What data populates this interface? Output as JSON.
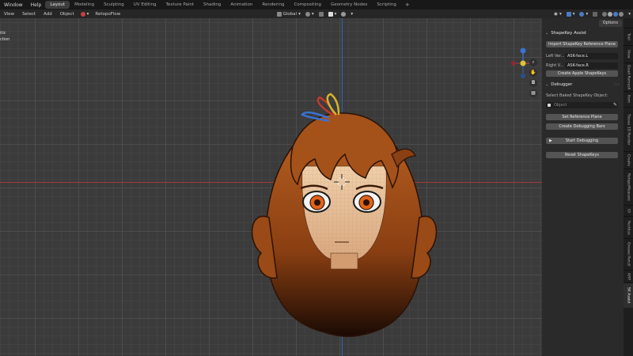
{
  "topbar": {
    "menus": [
      "Window",
      "Help"
    ],
    "workspaces": [
      "Layout",
      "Modeling",
      "Sculpting",
      "UV Editing",
      "Texture Paint",
      "Shading",
      "Animation",
      "Rendering",
      "Compositing",
      "Geometry Nodes",
      "Scripting"
    ],
    "active_workspace": "Layout",
    "add_tab": "+"
  },
  "header": {
    "menus": [
      "View",
      "Select",
      "Add",
      "Object"
    ],
    "addon_menu": "RetopoFlow",
    "transform_orientation": "Global"
  },
  "viewport": {
    "left_text": [
      "itic",
      "ction"
    ]
  },
  "sidebar": {
    "options_label": "Options",
    "shapekey_assist": {
      "title": "ShapeKey Assist",
      "import_button": "Import ShapeKey Reference Plane",
      "left_label": "Left Ver...",
      "left_value": "ASK-face.L",
      "right_label": "Right V...",
      "right_value": "ASK-face.R",
      "create_button": "Create Apple ShapeKeys"
    },
    "debugger": {
      "title": "Debugger",
      "select_label": "Select Baked ShapeKey Object:",
      "object_placeholder": "Object",
      "set_ref_button": "Set Reference Plane",
      "create_bars_button": "Create Debugging Bars",
      "start_button": "Start Debugging",
      "reset_button": "Reset ShapeKeys"
    },
    "tabs": [
      "Tool",
      "View",
      "Quad Remesh",
      "Item",
      "Tissue 3D Render",
      "Create",
      "RetopoMeasure",
      "ID",
      "Rectilux",
      "Grease Pencil",
      "ARP",
      "SK Assist"
    ],
    "active_tab": "SK Assist"
  },
  "colors": {
    "x_axis": "#a33a3a",
    "y_axis": "#2d66b8",
    "gizmo_blue": "#3a72d4",
    "gizmo_yellow": "#d8c63a",
    "gizmo_red": "#d23c4a",
    "gizmo_green": "#5aa83a"
  }
}
